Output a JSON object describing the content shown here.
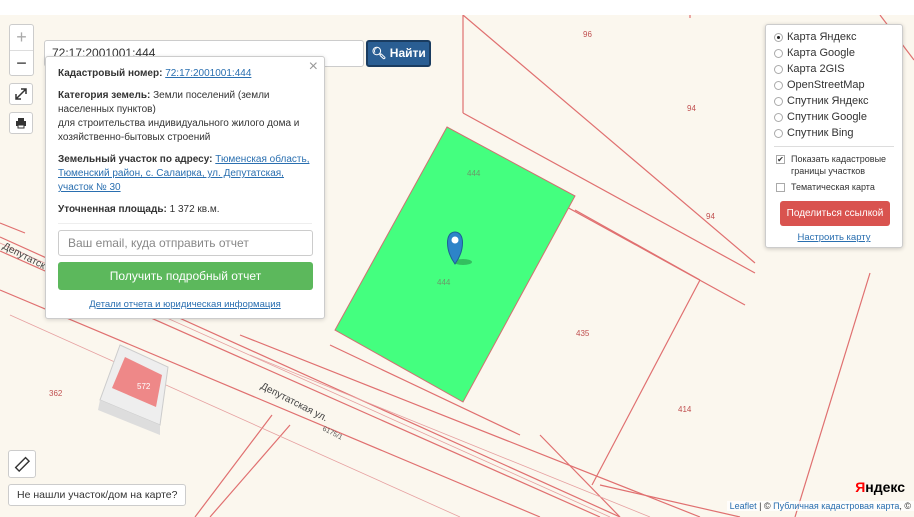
{
  "search": {
    "value": "72:17:2001001:444",
    "button_label": "Найти"
  },
  "zoom": {
    "in_label": "+",
    "out_label": "−"
  },
  "popup": {
    "close_label": "×",
    "cadastral_label": "Кадастровый номер:",
    "cadastral_value": "72:17:2001001:444",
    "category_label": "Категория земель:",
    "category_value": "Земли поселений (земли населенных пунктов)",
    "purpose": "для строительства индивидуального жилого дома и хозяйственно-бытовых строений",
    "address_label": "Земельный участок по адресу:",
    "address_value": "Тюменская область, Тюменский район, с. Салаирка, ул. Депутатская, участок № 30",
    "area_label": "Уточненная площадь:",
    "area_value": "1 372 кв.м.",
    "email_placeholder": "Ваш email, куда отправить отчет",
    "report_button": "Получить подробный отчет",
    "details_link": "Детали отчета и юридическая информация"
  },
  "layers": {
    "maps": [
      {
        "label": "Карта Яндекс",
        "selected": true
      },
      {
        "label": "Карта Google",
        "selected": false
      },
      {
        "label": "Карта 2GIS",
        "selected": false
      },
      {
        "label": "OpenStreetMap",
        "selected": false
      },
      {
        "label": "Спутник Яндекс",
        "selected": false
      },
      {
        "label": "Спутник Google",
        "selected": false
      },
      {
        "label": "Спутник Bing",
        "selected": false
      }
    ],
    "show_borders": "Показать кадастровые границы участков",
    "show_borders_checked": true,
    "thematic": "Тематическая карта",
    "thematic_checked": false,
    "share_button": "Поделиться ссылкой",
    "setup_link": "Настроить карту"
  },
  "map_labels": {
    "n96": "96",
    "n94a": "94",
    "n94b": "94",
    "n444a": "444",
    "n444b": "444",
    "n435": "435",
    "n414": "414",
    "n362": "362",
    "n572": "572",
    "street1": "Депутатская ул.",
    "street2": "Депутатск",
    "street_code": "6175/1"
  },
  "not_found": "Не нашли участок/дом на карте?",
  "attribution": {
    "leaflet": "Leaflet",
    "pkk": "Публичная кадастровая карта",
    "sep": " | © ",
    "tail": ", ©"
  },
  "yandex_logo": {
    "y": "Я",
    "rest": "ндекс"
  },
  "colors": {
    "parcel_fill": "#44ff7f",
    "boundary": "#e06060",
    "find_button": "#2a5e93",
    "report_button": "#5cb85c",
    "share_button": "#d9534f"
  },
  "icons": {
    "fullscreen": "expand-icon",
    "print": "print-icon",
    "ruler": "ruler-icon",
    "marker": "map-marker-icon",
    "search": "search-icon"
  }
}
